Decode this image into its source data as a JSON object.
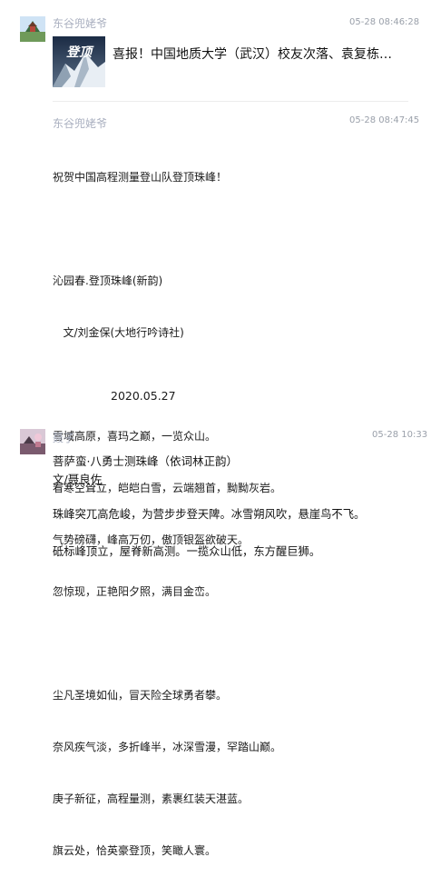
{
  "messages": [
    {
      "sender": "东谷兜姥爷",
      "time": "05-28 08:46:28",
      "share": {
        "title": "喜报！中国地质大学（武汉）校友次落、袁复栋…",
        "thumb_text": "登顶"
      }
    },
    {
      "sender": "东谷兜姥爷",
      "time": "05-28 08:47:45",
      "lines": [
        "祝贺中国高程测量登山队登顶珠峰！",
        "",
        "沁园春.登顶珠峰(新韵)",
        "   文/刘金保(大地行吟诗社)",
        "",
        "雪域高原，喜玛之巅，一览众山。",
        "看寒空耸立，皑皑白雪，云端翘首，黝黝灰岩。",
        "气势磅礴，峰高万仞，傲顶银盔欲破天。",
        "忽惊现，正艳阳夕照，满目金峦。",
        "",
        "尘凡圣境如仙，冒天险全球勇者攀。",
        "奈风疾气淡，多折峰半，冰深雪漫，罕踏山巅。",
        "庚子新征，高程量测，素裹红装天湛蓝。",
        "旗云处，恰英豪登顶，笑瞰人寰。"
      ],
      "date": "2020.05.27"
    },
    {
      "sender": "聂子",
      "time": "05-28 10:33",
      "lines": [
        "菩萨蛮·八勇士测珠峰（依词林正韵）",
        "文/聂良佐",
        "珠峰突兀高危峻，为营步步登天陴。冰雪朔风吹，悬崖鸟不飞。",
        "砥标峰顶立，屋脊新高测。一揽众山低，东方醒巨狮。"
      ]
    }
  ],
  "colors": {
    "name": "#aab0c0",
    "time": "#9aa0aa",
    "text": "#1a1a1a",
    "divider": "#ececec"
  }
}
